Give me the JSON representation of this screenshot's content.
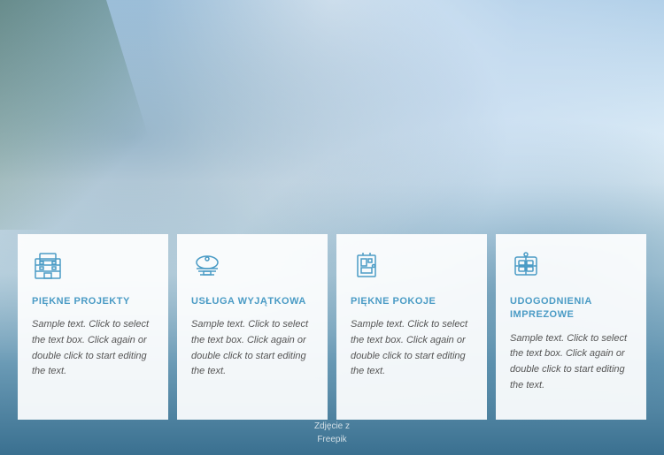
{
  "background": {
    "alt": "Hotel pool with buildings background"
  },
  "cards": [
    {
      "id": "card-1",
      "icon": "building-icon",
      "title": "PIĘKNE PROJEKTY",
      "text": "Sample text. Click to select the text box. Click again or double click to start editing the text."
    },
    {
      "id": "card-2",
      "icon": "service-icon",
      "title": "USŁUGA WYJĄTKOWA",
      "text": "Sample text. Click to select the text box. Click again or double click to start editing the text."
    },
    {
      "id": "card-3",
      "icon": "room-icon",
      "title": "PIĘKNE POKOJE",
      "text": "Sample text. Click to select the text box. Click again or double click to start editing the text."
    },
    {
      "id": "card-4",
      "icon": "amenity-icon",
      "title": "UDOGODNIENIA IMPREZOWE",
      "text": "Sample text. Click to select the text box. Click again or double click to start editing the text."
    }
  ],
  "footer": {
    "line1": "Zdjęcie z",
    "line2": "Freepik"
  }
}
